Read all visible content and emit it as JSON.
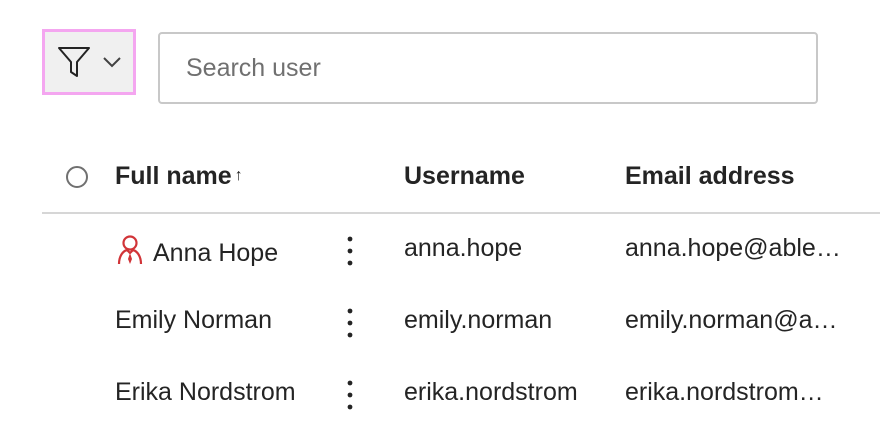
{
  "toolbar": {
    "filter_icon": "filter-funnel-icon",
    "dropdown_icon": "chevron-down-icon",
    "search_placeholder": "Search user",
    "search_value": ""
  },
  "table": {
    "columns": {
      "full_name": "Full name",
      "sort_indicator": "↑",
      "username": "Username",
      "email": "Email address"
    },
    "rows": [
      {
        "full_name": "Anna Hope",
        "username": "anna.hope",
        "email": "anna.hope@able…",
        "admin_icon": "admin-person-icon"
      },
      {
        "full_name": "Emily Norman",
        "username": "emily.norman",
        "email": "emily.norman@a…"
      },
      {
        "full_name": "Erika Nordstrom",
        "username": "erika.nordstrom",
        "email": "erika.nordstrom…"
      }
    ]
  },
  "colors": {
    "focus_outline": "#f4a6f0",
    "admin_icon": "#d13438",
    "divider": "#d6d6d6"
  }
}
